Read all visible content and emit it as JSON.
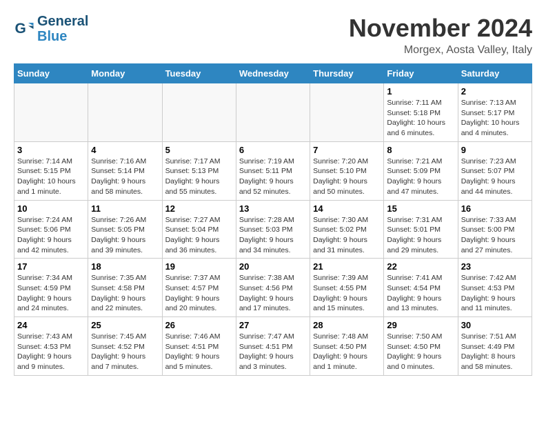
{
  "header": {
    "logo_line1": "General",
    "logo_line2": "Blue",
    "month": "November 2024",
    "location": "Morgex, Aosta Valley, Italy"
  },
  "weekdays": [
    "Sunday",
    "Monday",
    "Tuesday",
    "Wednesday",
    "Thursday",
    "Friday",
    "Saturday"
  ],
  "weeks": [
    [
      {
        "day": "",
        "info": "",
        "empty": true
      },
      {
        "day": "",
        "info": "",
        "empty": true
      },
      {
        "day": "",
        "info": "",
        "empty": true
      },
      {
        "day": "",
        "info": "",
        "empty": true
      },
      {
        "day": "",
        "info": "",
        "empty": true
      },
      {
        "day": "1",
        "info": "Sunrise: 7:11 AM\nSunset: 5:18 PM\nDaylight: 10 hours\nand 6 minutes.",
        "empty": false
      },
      {
        "day": "2",
        "info": "Sunrise: 7:13 AM\nSunset: 5:17 PM\nDaylight: 10 hours\nand 4 minutes.",
        "empty": false
      }
    ],
    [
      {
        "day": "3",
        "info": "Sunrise: 7:14 AM\nSunset: 5:15 PM\nDaylight: 10 hours\nand 1 minute.",
        "empty": false
      },
      {
        "day": "4",
        "info": "Sunrise: 7:16 AM\nSunset: 5:14 PM\nDaylight: 9 hours\nand 58 minutes.",
        "empty": false
      },
      {
        "day": "5",
        "info": "Sunrise: 7:17 AM\nSunset: 5:13 PM\nDaylight: 9 hours\nand 55 minutes.",
        "empty": false
      },
      {
        "day": "6",
        "info": "Sunrise: 7:19 AM\nSunset: 5:11 PM\nDaylight: 9 hours\nand 52 minutes.",
        "empty": false
      },
      {
        "day": "7",
        "info": "Sunrise: 7:20 AM\nSunset: 5:10 PM\nDaylight: 9 hours\nand 50 minutes.",
        "empty": false
      },
      {
        "day": "8",
        "info": "Sunrise: 7:21 AM\nSunset: 5:09 PM\nDaylight: 9 hours\nand 47 minutes.",
        "empty": false
      },
      {
        "day": "9",
        "info": "Sunrise: 7:23 AM\nSunset: 5:07 PM\nDaylight: 9 hours\nand 44 minutes.",
        "empty": false
      }
    ],
    [
      {
        "day": "10",
        "info": "Sunrise: 7:24 AM\nSunset: 5:06 PM\nDaylight: 9 hours\nand 42 minutes.",
        "empty": false
      },
      {
        "day": "11",
        "info": "Sunrise: 7:26 AM\nSunset: 5:05 PM\nDaylight: 9 hours\nand 39 minutes.",
        "empty": false
      },
      {
        "day": "12",
        "info": "Sunrise: 7:27 AM\nSunset: 5:04 PM\nDaylight: 9 hours\nand 36 minutes.",
        "empty": false
      },
      {
        "day": "13",
        "info": "Sunrise: 7:28 AM\nSunset: 5:03 PM\nDaylight: 9 hours\nand 34 minutes.",
        "empty": false
      },
      {
        "day": "14",
        "info": "Sunrise: 7:30 AM\nSunset: 5:02 PM\nDaylight: 9 hours\nand 31 minutes.",
        "empty": false
      },
      {
        "day": "15",
        "info": "Sunrise: 7:31 AM\nSunset: 5:01 PM\nDaylight: 9 hours\nand 29 minutes.",
        "empty": false
      },
      {
        "day": "16",
        "info": "Sunrise: 7:33 AM\nSunset: 5:00 PM\nDaylight: 9 hours\nand 27 minutes.",
        "empty": false
      }
    ],
    [
      {
        "day": "17",
        "info": "Sunrise: 7:34 AM\nSunset: 4:59 PM\nDaylight: 9 hours\nand 24 minutes.",
        "empty": false
      },
      {
        "day": "18",
        "info": "Sunrise: 7:35 AM\nSunset: 4:58 PM\nDaylight: 9 hours\nand 22 minutes.",
        "empty": false
      },
      {
        "day": "19",
        "info": "Sunrise: 7:37 AM\nSunset: 4:57 PM\nDaylight: 9 hours\nand 20 minutes.",
        "empty": false
      },
      {
        "day": "20",
        "info": "Sunrise: 7:38 AM\nSunset: 4:56 PM\nDaylight: 9 hours\nand 17 minutes.",
        "empty": false
      },
      {
        "day": "21",
        "info": "Sunrise: 7:39 AM\nSunset: 4:55 PM\nDaylight: 9 hours\nand 15 minutes.",
        "empty": false
      },
      {
        "day": "22",
        "info": "Sunrise: 7:41 AM\nSunset: 4:54 PM\nDaylight: 9 hours\nand 13 minutes.",
        "empty": false
      },
      {
        "day": "23",
        "info": "Sunrise: 7:42 AM\nSunset: 4:53 PM\nDaylight: 9 hours\nand 11 minutes.",
        "empty": false
      }
    ],
    [
      {
        "day": "24",
        "info": "Sunrise: 7:43 AM\nSunset: 4:53 PM\nDaylight: 9 hours\nand 9 minutes.",
        "empty": false
      },
      {
        "day": "25",
        "info": "Sunrise: 7:45 AM\nSunset: 4:52 PM\nDaylight: 9 hours\nand 7 minutes.",
        "empty": false
      },
      {
        "day": "26",
        "info": "Sunrise: 7:46 AM\nSunset: 4:51 PM\nDaylight: 9 hours\nand 5 minutes.",
        "empty": false
      },
      {
        "day": "27",
        "info": "Sunrise: 7:47 AM\nSunset: 4:51 PM\nDaylight: 9 hours\nand 3 minutes.",
        "empty": false
      },
      {
        "day": "28",
        "info": "Sunrise: 7:48 AM\nSunset: 4:50 PM\nDaylight: 9 hours\nand 1 minute.",
        "empty": false
      },
      {
        "day": "29",
        "info": "Sunrise: 7:50 AM\nSunset: 4:50 PM\nDaylight: 9 hours\nand 0 minutes.",
        "empty": false
      },
      {
        "day": "30",
        "info": "Sunrise: 7:51 AM\nSunset: 4:49 PM\nDaylight: 8 hours\nand 58 minutes.",
        "empty": false
      }
    ]
  ]
}
